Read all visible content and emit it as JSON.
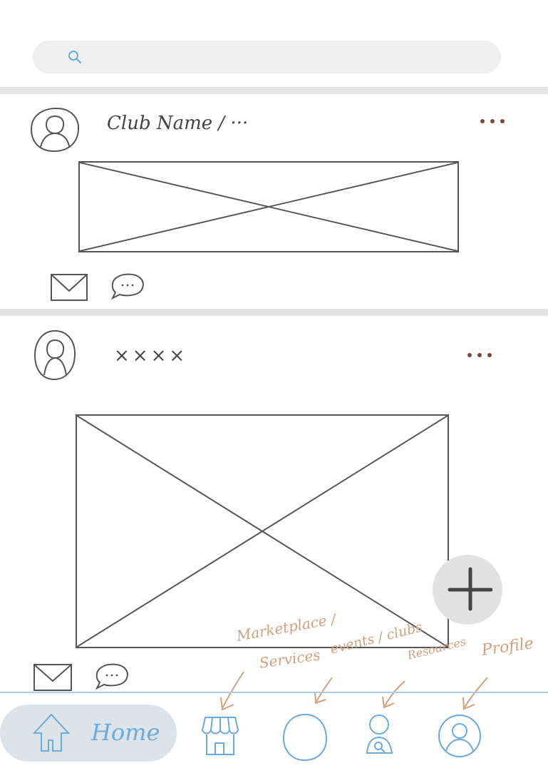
{
  "search": {
    "placeholder": ""
  },
  "posts": [
    {
      "author": "Club Name / ···"
    },
    {
      "author": "××××"
    }
  ],
  "annotations": {
    "marketplace": "Marketplace /",
    "services": "Services",
    "events": "events / clubs",
    "resources": "Resources",
    "profile": "Profile"
  },
  "nav": {
    "home_label": "Home"
  },
  "colors": {
    "accent": "#6aaadc",
    "note": "#d2a07c",
    "divider": "#e3e3e3",
    "sketch_line": "#555555",
    "more_dots": "#7a4a38"
  },
  "icons": {
    "search": "search-icon",
    "avatar": "avatar-icon",
    "more": "more-dots-icon",
    "mail": "mail-icon",
    "comment": "comment-icon",
    "plus": "plus-icon",
    "home": "home-icon",
    "store": "store-icon",
    "events": "circle-icon",
    "resources": "resources-icon",
    "profile": "profile-icon"
  }
}
